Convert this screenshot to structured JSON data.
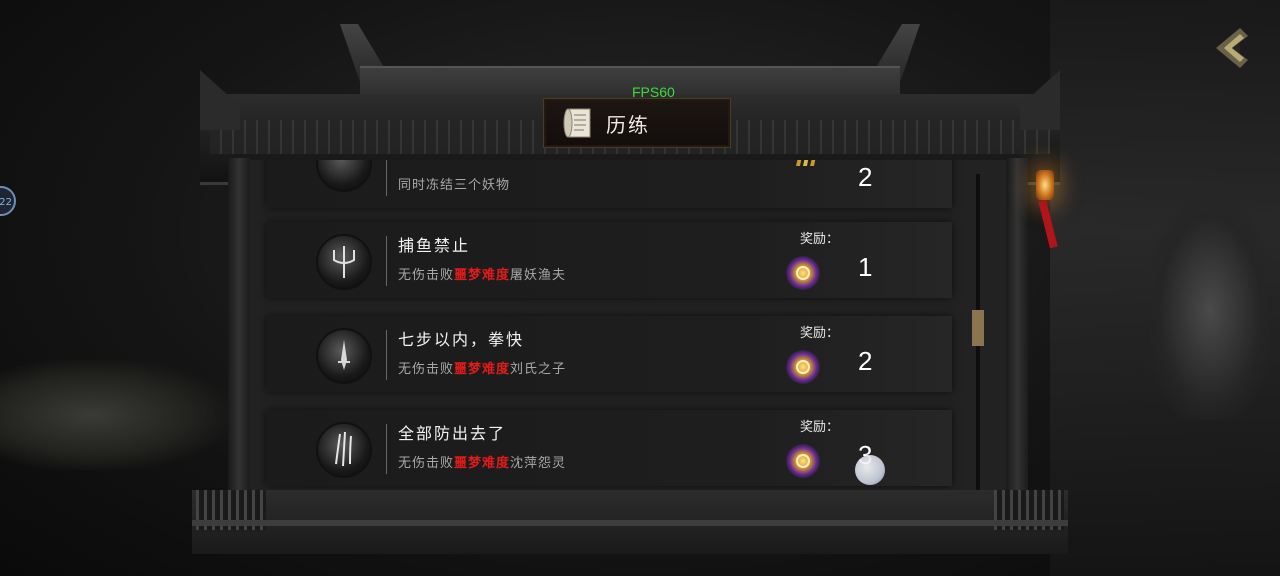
{
  "hud": {
    "fps": "FPS60",
    "side_badge": "22"
  },
  "window": {
    "title": "历练"
  },
  "achievements": [
    {
      "title": "",
      "desc_prefix": "同时冻结三个妖物",
      "desc_highlight": "",
      "desc_suffix": "",
      "reward_label": "",
      "reward_icon": "claw-token-icon",
      "reward_count": "2"
    },
    {
      "title": "捕鱼禁止",
      "desc_prefix": "无伤击败",
      "desc_highlight": "噩梦难度",
      "desc_suffix": "屠妖渔夫",
      "reward_label": "奖励：",
      "reward_icon": "gold-orb-icon",
      "reward_count": "1"
    },
    {
      "title": "七步以内，拳快",
      "desc_prefix": "无伤击败",
      "desc_highlight": "噩梦难度",
      "desc_suffix": "刘氏之子",
      "reward_label": "奖励：",
      "reward_icon": "gold-orb-icon",
      "reward_count": "2"
    },
    {
      "title": "全部防出去了",
      "desc_prefix": "无伤击败",
      "desc_highlight": "噩梦难度",
      "desc_suffix": "沈萍怨灵",
      "reward_label": "奖励：",
      "reward_icon": "gold-orb-icon",
      "reward_count": "3"
    }
  ],
  "colors": {
    "fps_text": "#3ddb3d",
    "highlight_red": "#e01b1b",
    "scroll_thumb": "#8a7550"
  }
}
